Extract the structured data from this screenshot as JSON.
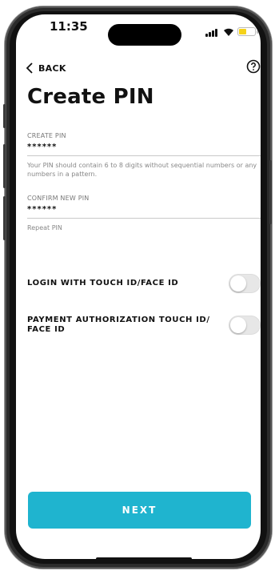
{
  "status": {
    "time": "11:35",
    "battery_level": 0.45
  },
  "header": {
    "back_label": "BACK",
    "title": "Create PIN"
  },
  "form": {
    "create_label": "CREATE PIN",
    "create_value": "******",
    "create_hint": "Your PIN should contain 6 to 8 digits without sequential numbers or any numbers in a pattern.",
    "confirm_label": "CONFIRM NEW PIN",
    "confirm_value": "******",
    "confirm_hint": "Repeat PIN"
  },
  "toggles": [
    {
      "label": "LOGIN WITH TOUCH ID/FACE ID",
      "on": false
    },
    {
      "label": "PAYMENT AUTHORIZATION TOUCH ID/ FACE ID",
      "on": false
    }
  ],
  "next_label": "NEXT",
  "colors": {
    "accent": "#1fb4cf",
    "battery": "#f5d21a"
  },
  "icons": [
    "chevron-left-icon",
    "help-icon",
    "signal-icon",
    "wifi-icon",
    "battery-icon"
  ]
}
